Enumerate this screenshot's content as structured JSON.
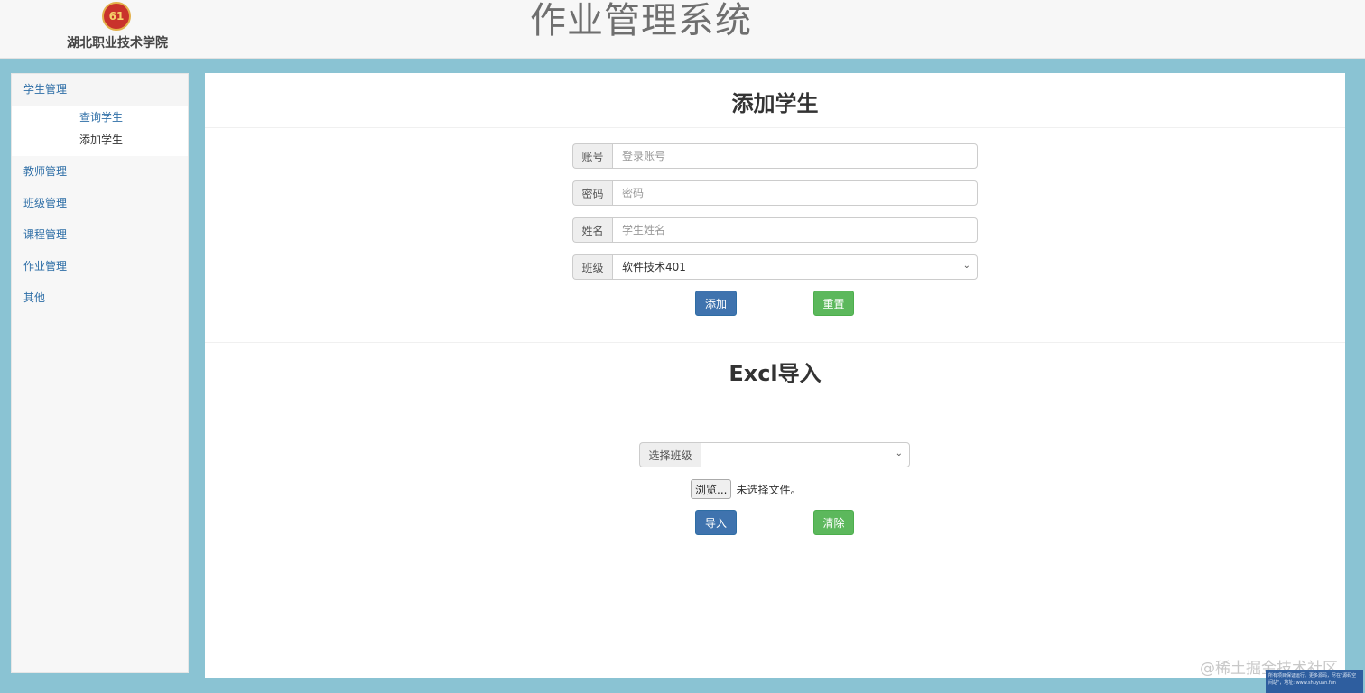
{
  "header": {
    "logo_text": "61",
    "school_name": "湖北职业技术学院",
    "app_title": "作业管理系统"
  },
  "sidebar": {
    "items": [
      {
        "label": "学生管理",
        "subitems": [
          "查询学生",
          "添加学生"
        ]
      },
      {
        "label": "教师管理"
      },
      {
        "label": "班级管理"
      },
      {
        "label": "课程管理"
      },
      {
        "label": "作业管理"
      },
      {
        "label": "其他"
      }
    ],
    "active_subitem": "添加学生"
  },
  "add_student": {
    "title": "添加学生",
    "account": {
      "label": "账号",
      "placeholder": "登录账号",
      "value": ""
    },
    "password": {
      "label": "密码",
      "placeholder": "密码",
      "value": ""
    },
    "name": {
      "label": "姓名",
      "placeholder": "学生姓名",
      "value": ""
    },
    "class": {
      "label": "班级",
      "selected": "软件技术401"
    },
    "add_button": "添加",
    "reset_button": "重置"
  },
  "excel_import": {
    "title": "Excl导入",
    "class_select": {
      "label": "选择班级",
      "selected": ""
    },
    "browse_button": "浏览...",
    "file_status": "未选择文件。",
    "import_button": "导入",
    "clear_button": "清除"
  },
  "watermark": "@稀土掘金技术社区",
  "notice_text": "所有项目保证运行。更多源码，尽在\"源码空间站\"，地址: www.shuyuan.fun",
  "colors": {
    "page_bg": "#8ac3d3",
    "primary": "#3f73ae",
    "success": "#5cb85c",
    "link": "#2f6fa7"
  },
  "icons": [
    "school-logo-icon",
    "chevron-down-icon"
  ]
}
